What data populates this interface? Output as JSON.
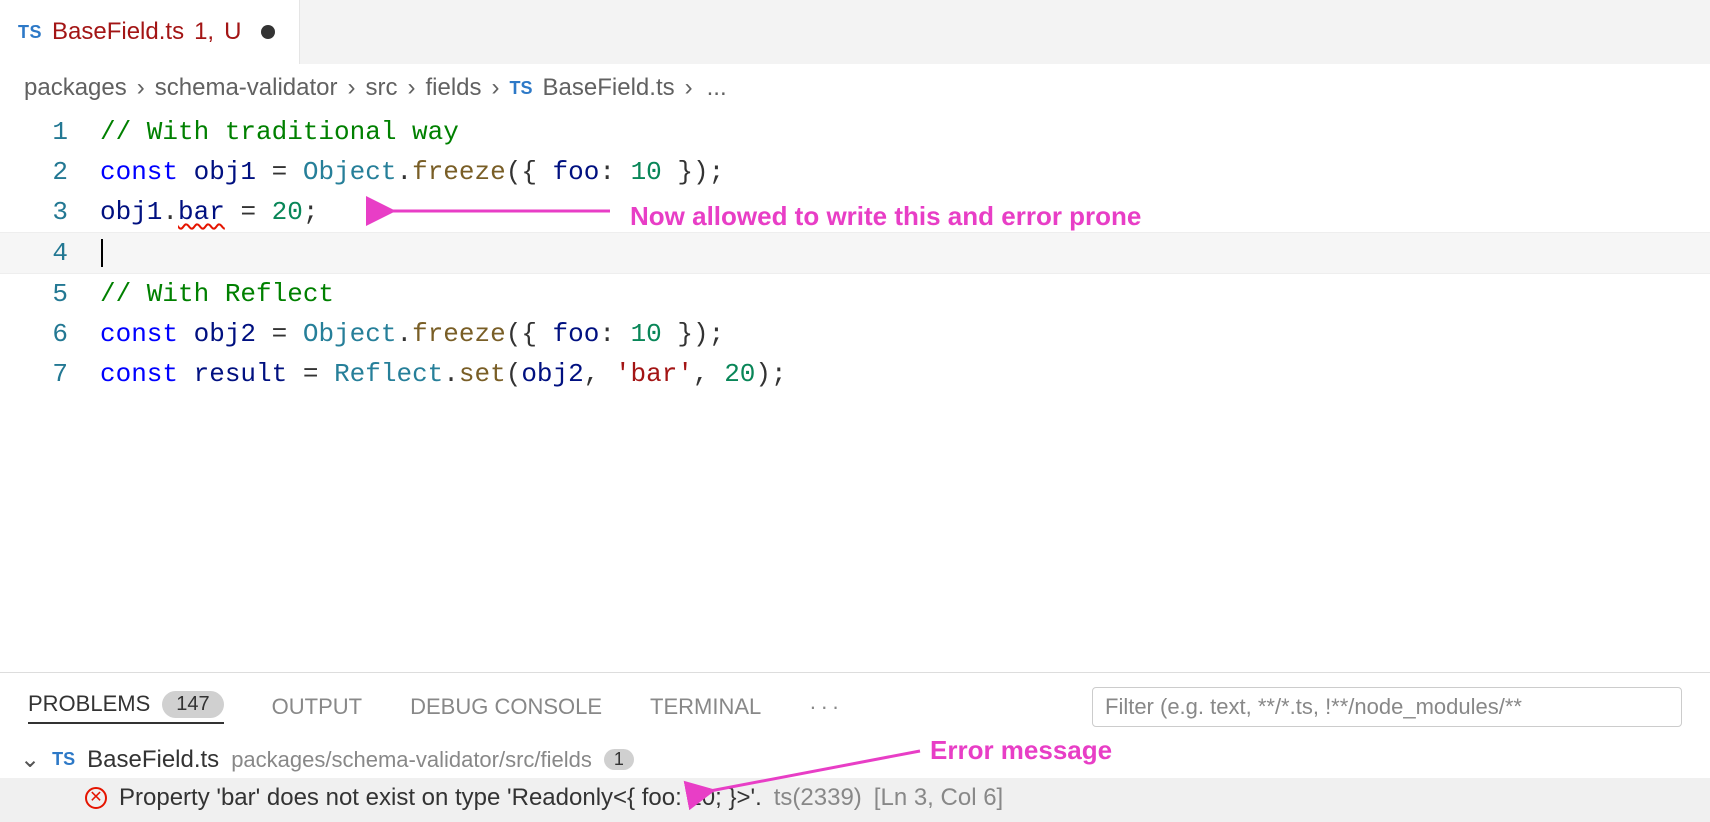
{
  "tab": {
    "icon_label": "TS",
    "filename": "BaseField.ts",
    "problem_count": "1,",
    "git_status": "U"
  },
  "breadcrumbs": {
    "segments": [
      "packages",
      "schema-validator",
      "src",
      "fields"
    ],
    "file_icon": "TS",
    "file": "BaseField.ts",
    "trail": "..."
  },
  "code": {
    "line1": {
      "num": "1",
      "comment": "// With traditional way"
    },
    "line2": {
      "num": "2",
      "kw_const": "const ",
      "ident": "obj1",
      "eq": " = ",
      "type": "Object",
      "dot": ".",
      "fn": "freeze",
      "open": "({ ",
      "prop": "foo",
      "colon": ": ",
      "val": "10",
      "close": " });"
    },
    "line3": {
      "num": "3",
      "ident": "obj1",
      "dot": ".",
      "bad": "bar",
      "eq": " = ",
      "val": "20",
      "semi": ";"
    },
    "line4": {
      "num": "4"
    },
    "line5": {
      "num": "5",
      "comment": "// With Reflect"
    },
    "line6": {
      "num": "6",
      "kw_const": "const ",
      "ident": "obj2",
      "eq": " = ",
      "type": "Object",
      "dot": ".",
      "fn": "freeze",
      "open": "({ ",
      "prop": "foo",
      "colon": ": ",
      "val": "10",
      "close": " });"
    },
    "line7": {
      "num": "7",
      "kw_const": "const ",
      "ident": "result",
      "eq": " = ",
      "type": "Reflect",
      "dot": ".",
      "fn": "set",
      "open": "(",
      "arg1": "obj2",
      "comma1": ", ",
      "str": "'bar'",
      "comma2": ", ",
      "val": "20",
      "close": ");"
    }
  },
  "annotations": {
    "line3_note": "Now allowed to write this and error prone",
    "error_note": "Error message"
  },
  "panel": {
    "tabs": {
      "problems": "PROBLEMS",
      "problems_count": "147",
      "output": "OUTPUT",
      "debug": "DEBUG CONSOLE",
      "terminal": "TERMINAL"
    },
    "filter_placeholder": "Filter (e.g. text, **/*.ts, !**/node_modules/**",
    "group": {
      "icon": "TS",
      "file": "BaseField.ts",
      "path": "packages/schema-validator/src/fields",
      "count": "1"
    },
    "error": {
      "message": "Property 'bar' does not exist on type 'Readonly<{ foo: 10; }>'.",
      "code": "ts(2339)",
      "location": "[Ln 3, Col 6]"
    }
  },
  "colors": {
    "annotation_accent": "#e83ec6",
    "error": "#e51400"
  }
}
